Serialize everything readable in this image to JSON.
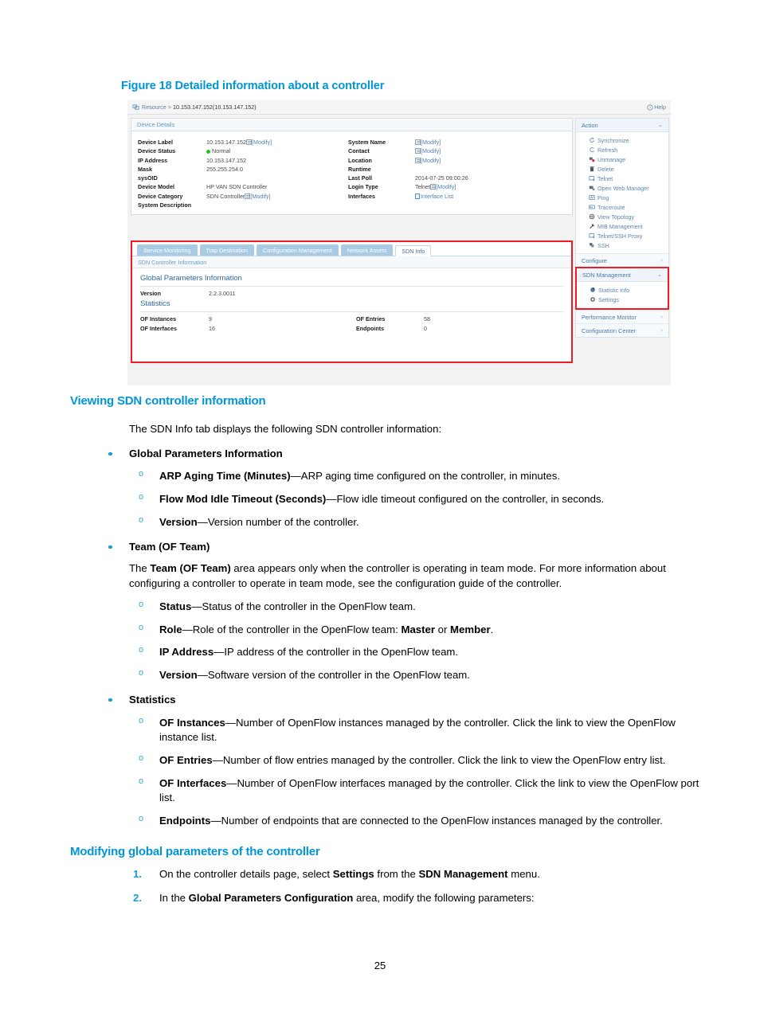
{
  "figure": {
    "caption": "Figure 18 Detailed information about a controller",
    "breadcrumb": {
      "root": "Resource",
      "separator": ">",
      "path": "10.153.147.152(10.153.147.152)"
    },
    "help_label": "Help",
    "panel_title": "Device Details",
    "device_details_left": [
      {
        "label": "Device Label",
        "value": "10.153.147.152",
        "modify": "[Modify]",
        "has_modify": true
      },
      {
        "label": "Device Status",
        "value": "Normal",
        "status_color": "#21c421"
      },
      {
        "label": "IP Address",
        "value": "10.153.147.152"
      },
      {
        "label": "Mask",
        "value": "255.255.254.0"
      },
      {
        "label": "sysOID",
        "value": ""
      },
      {
        "label": "Device Model",
        "value": "HP VAN SDN Controller"
      },
      {
        "label": "Device Category",
        "value": "SDN Controller",
        "modify": "[Modify]",
        "has_modify": true
      },
      {
        "label": "System Description",
        "value": ""
      }
    ],
    "device_details_right": [
      {
        "label": "System Name",
        "value": "",
        "modify": "[Modify]",
        "has_modify": true
      },
      {
        "label": "Contact",
        "value": "",
        "modify": "[Modify]",
        "has_modify": true
      },
      {
        "label": "Location",
        "value": "",
        "modify": "[Modify]",
        "has_modify": true
      },
      {
        "label": "Runtime",
        "value": ""
      },
      {
        "label": "Last Poll",
        "value": "2014-07-25 09:00:26"
      },
      {
        "label": "Login Type",
        "value": "Telnet",
        "modify": "[Modify]",
        "has_modify": true
      },
      {
        "label": "Interfaces",
        "value": "Interface List",
        "is_link": true
      }
    ],
    "tabs": [
      {
        "label": "Service Monitoring",
        "active": false
      },
      {
        "label": "Trap Destination",
        "active": false
      },
      {
        "label": "Configuration Management",
        "active": false
      },
      {
        "label": "Network Assets",
        "active": false
      },
      {
        "label": "SDN Info",
        "active": true
      }
    ],
    "sdn_panel_title": "SDN Controller Information",
    "global_params_title": "Global Parameters Information",
    "version_label": "Version",
    "version_value": "2.2.3.0011",
    "statistics_title": "Statistics",
    "statistics": [
      {
        "label": "OF Instances",
        "value": "9",
        "is_link": true
      },
      {
        "label": "OF Entries",
        "value": "58",
        "is_link": true
      },
      {
        "label": "OF Interfaces",
        "value": "16",
        "is_link": true
      },
      {
        "label": "Endpoints",
        "value": "0",
        "is_link": false
      }
    ],
    "action": {
      "title": "Action",
      "chevron": "⌄",
      "items": [
        {
          "label": "Synchronize",
          "icon": "sync-icon"
        },
        {
          "label": "Refresh",
          "icon": "refresh-icon"
        },
        {
          "label": "Unmanage",
          "icon": "unmanage-icon"
        },
        {
          "label": "Delete",
          "icon": "trash-icon"
        },
        {
          "label": "Telnet",
          "icon": "telnet-icon"
        },
        {
          "label": "Open Web Manager",
          "icon": "web-manager-icon"
        },
        {
          "label": "Ping",
          "icon": "ping-icon"
        },
        {
          "label": "Traceroute",
          "icon": "traceroute-icon"
        },
        {
          "label": "View Topology",
          "icon": "topology-icon"
        },
        {
          "label": "MIB Management",
          "icon": "wrench-icon"
        },
        {
          "label": "Telnet/SSH Proxy",
          "icon": "telnet-ssh-proxy-icon"
        },
        {
          "label": "SSH",
          "icon": "ssh-icon"
        }
      ]
    },
    "configure": {
      "title": "Configure",
      "chevron": "›"
    },
    "sdn_management": {
      "title": "SDN Management",
      "chevron": "⌄",
      "items": [
        {
          "label": "Statistic Info",
          "icon": "pie-chart-icon"
        },
        {
          "label": "Settings",
          "icon": "gear-icon"
        }
      ]
    },
    "performance_monitor": {
      "title": "Performance Monitor",
      "chevron": "›"
    },
    "configuration_center": {
      "title": "Configuration Center",
      "chevron": "›"
    },
    "accent_red": "#ee1c25",
    "accent_blue": "#0096d6"
  },
  "doc": {
    "section1_heading": "Viewing SDN controller information",
    "section1_intro": "The SDN Info tab displays the following SDN controller information:",
    "bullet_global": "Global Parameters Information",
    "sub_arp": {
      "term": "ARP Aging Time (Minutes)",
      "desc": "—ARP aging time configured on the controller, in minutes."
    },
    "sub_flow": {
      "term": "Flow Mod Idle Timeout (Seconds)",
      "desc": "—Flow idle timeout configured on the controller, in seconds."
    },
    "sub_version": {
      "term": "Version",
      "desc": "—Version number of the controller."
    },
    "bullet_team": "Team (OF Team)",
    "team_para_1": "The ",
    "team_para_bold": "Team (OF Team)",
    "team_para_2": " area appears only when the controller is operating in team mode. For more information about configuring a controller to operate in team mode, see the configuration guide of the controller.",
    "sub_status": {
      "term": "Status",
      "desc": "—Status of the controller in the OpenFlow team."
    },
    "sub_role": {
      "term": "Role",
      "desc_a": "—Role of the controller in the OpenFlow team: ",
      "bold_a": "Master",
      "mid": " or ",
      "bold_b": "Member",
      "desc_b": "."
    },
    "sub_ip": {
      "term": "IP Address",
      "desc": "—IP address of the controller in the OpenFlow team."
    },
    "sub_version_team": {
      "term": "Version",
      "desc": "—Software version of the controller in the OpenFlow team."
    },
    "bullet_statistics": "Statistics",
    "sub_of_instances": {
      "term": "OF Instances",
      "desc": "—Number of OpenFlow instances managed by the controller. Click the link to view the OpenFlow instance list."
    },
    "sub_of_entries": {
      "term": "OF Entries",
      "desc": "—Number of flow entries managed by the controller. Click the link to view the OpenFlow entry list."
    },
    "sub_of_interfaces": {
      "term": "OF Interfaces",
      "desc": "—Number of OpenFlow interfaces managed by the controller. Click the link to view the OpenFlow port list."
    },
    "sub_endpoints": {
      "term": "Endpoints",
      "desc": "—Number of endpoints that are connected to the OpenFlow instances managed by the controller."
    },
    "section2_heading": "Modifying global parameters of the controller",
    "step1": {
      "num": "1.",
      "a": "On the controller details page, select ",
      "b1": "Settings",
      "mid": " from the ",
      "b2": "SDN Management",
      "c": " menu."
    },
    "step2": {
      "num": "2.",
      "a": "In the ",
      "b1": "Global Parameters Configuration",
      "c": " area, modify the following parameters:"
    },
    "page_number": "25"
  }
}
